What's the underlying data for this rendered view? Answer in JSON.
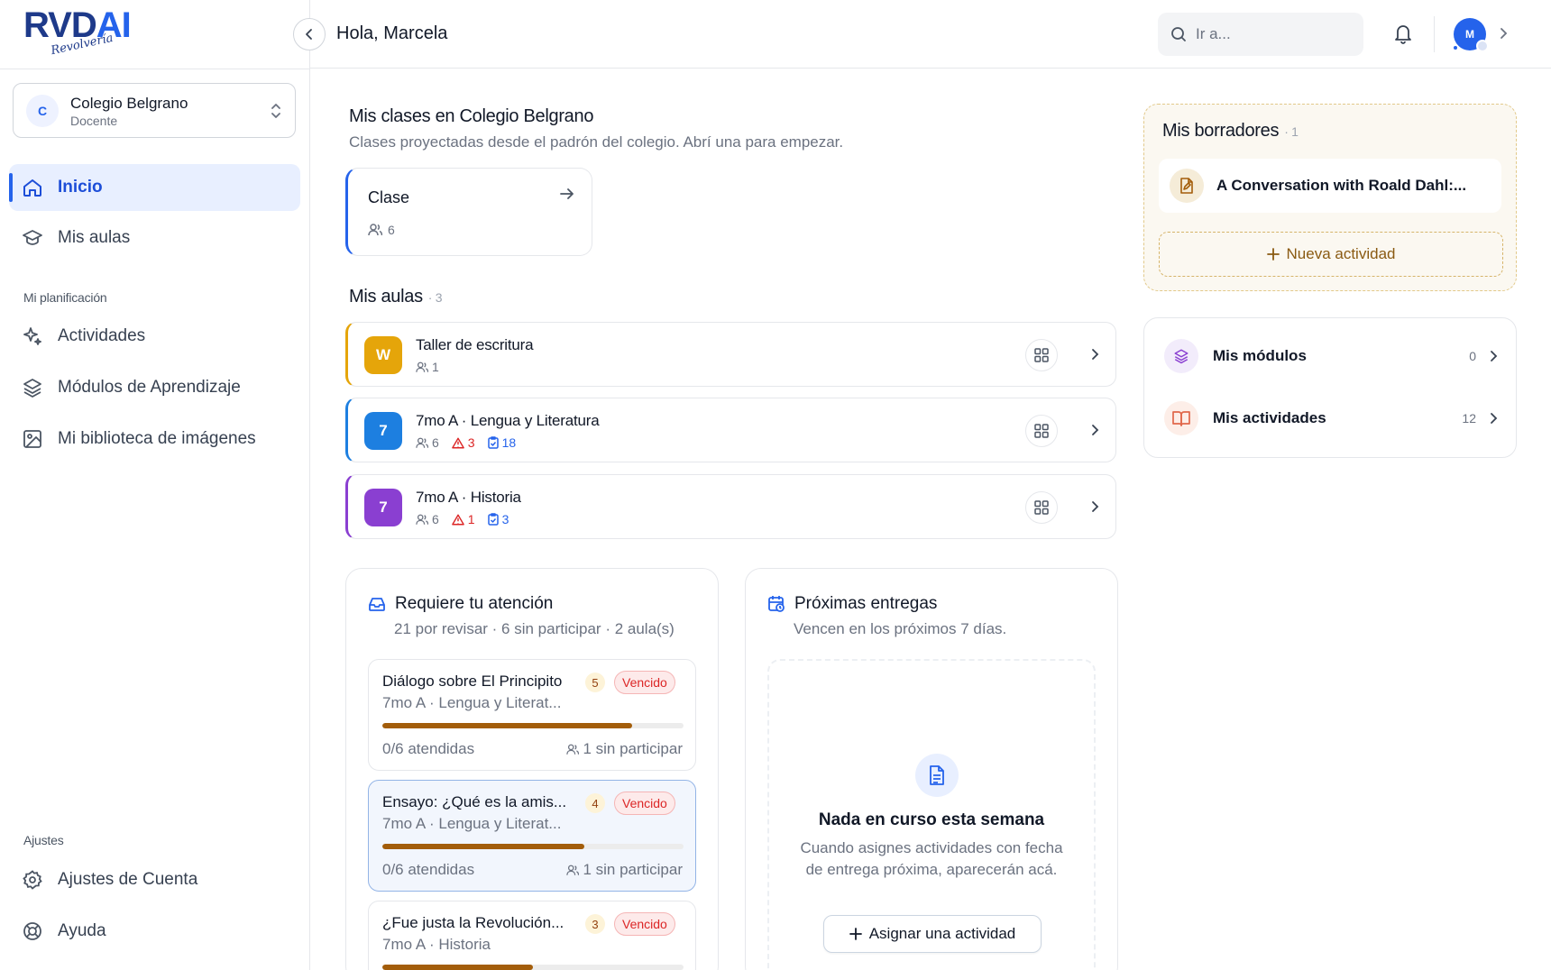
{
  "brand": {
    "logo_main": "RVDAI",
    "logo_script": "Revolvería"
  },
  "school": {
    "initial": "C",
    "name": "Colegio Belgrano",
    "role": "Docente"
  },
  "nav": {
    "inicio": "Inicio",
    "mis_aulas": "Mis aulas",
    "section_planificacion": "Mi planificación",
    "actividades": "Actividades",
    "modulos": "Módulos de Aprendizaje",
    "biblioteca": "Mi biblioteca de imágenes",
    "section_ajustes": "Ajustes",
    "ajustes_cuenta": "Ajustes de Cuenta",
    "ayuda": "Ayuda"
  },
  "topbar": {
    "greeting": "Hola, Marcela",
    "search_placeholder": "Ir a...",
    "avatar_initial": "M"
  },
  "clases": {
    "title": "Mis clases en Colegio Belgrano",
    "subtitle": "Clases proyectadas desde el padrón del colegio. Abrí una para empezar.",
    "card": {
      "name": "Clase",
      "students": "6"
    }
  },
  "aulas": {
    "title": "Mis aulas",
    "count": "· 3",
    "items": [
      {
        "initial": "W",
        "name": "Taller de escritura",
        "students": "1",
        "color": "#e5a50a",
        "alerts": "",
        "tasks": ""
      },
      {
        "initial": "7",
        "name": "7mo A · Lengua y Literatura",
        "students": "6",
        "color": "#1d7fe0",
        "alerts": "3",
        "tasks": "18"
      },
      {
        "initial": "7",
        "name": "7mo A · Historia",
        "students": "6",
        "color": "#8a3fd1",
        "alerts": "1",
        "tasks": "3"
      }
    ]
  },
  "atencion": {
    "title": "Requiere tu atención",
    "subtitle": "21 por revisar · 6 sin participar · 2 aula(s)",
    "items": [
      {
        "title": "Diálogo sobre El Principito",
        "count": "5",
        "status": "Vencido",
        "class": "7mo A · Lengua y Literat...",
        "progress": 0.83,
        "attended": "0/6 atendidas",
        "missing": "1 sin participar"
      },
      {
        "title": "Ensayo: ¿Qué es la amis...",
        "count": "4",
        "status": "Vencido",
        "class": "7mo A · Lengua y Literat...",
        "progress": 0.67,
        "attended": "0/6 atendidas",
        "missing": "1 sin participar"
      },
      {
        "title": "¿Fue justa la Revolución...",
        "count": "3",
        "status": "Vencido",
        "class": "7mo A · Historia",
        "progress": 0.5,
        "attended": "",
        "missing": ""
      }
    ]
  },
  "entregas": {
    "title": "Próximas entregas",
    "subtitle": "Vencen en los próximos 7 días.",
    "empty_title": "Nada en curso esta semana",
    "empty_desc": "Cuando asignes actividades con fecha de entrega próxima, aparecerán acá.",
    "assign_label": "Asignar una actividad"
  },
  "borradores": {
    "title": "Mis borradores",
    "count": "· 1",
    "item": "A Conversation with Roald Dahl:...",
    "new_label": "Nueva actividad"
  },
  "resumen": {
    "modulos_label": "Mis módulos",
    "modulos_count": "0",
    "actividades_label": "Mis actividades",
    "actividades_count": "12"
  },
  "colors": {
    "accent": "#2563eb",
    "warning": "#dc2626",
    "progress": "#a35d0a"
  }
}
